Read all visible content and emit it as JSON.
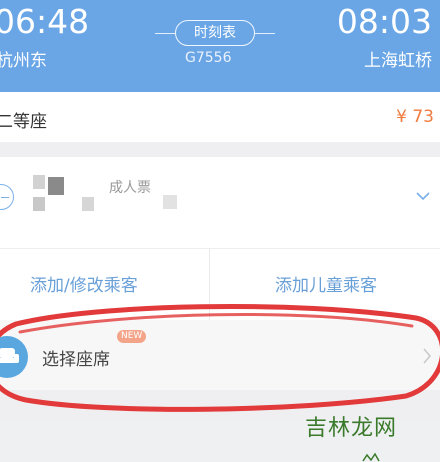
{
  "header": {
    "departure_time": "06:48",
    "departure_station": "杭州东",
    "arrival_time": "08:03",
    "arrival_station": "上海虹桥",
    "timetable_label": "时刻表",
    "train_number": "G7556"
  },
  "seat": {
    "class_label": "二等座",
    "price": "¥ 73"
  },
  "passenger": {
    "ticket_type": "成人票"
  },
  "actions": {
    "add_passenger": "添加/修改乘客",
    "add_child": "添加儿童乘客"
  },
  "seat_selection": {
    "label": "选择座席",
    "badge": "NEW"
  },
  "watermark": "吉林龙网",
  "colors": {
    "header_bg": "#6aa6e6",
    "price": "#f07b3f",
    "link": "#6aa0d8",
    "annotation": "#e23a3a"
  },
  "icons": {
    "remove": "minus-circle-icon",
    "expand": "chevron-down-icon",
    "seat": "armchair-icon",
    "next": "chevron-right-icon"
  }
}
